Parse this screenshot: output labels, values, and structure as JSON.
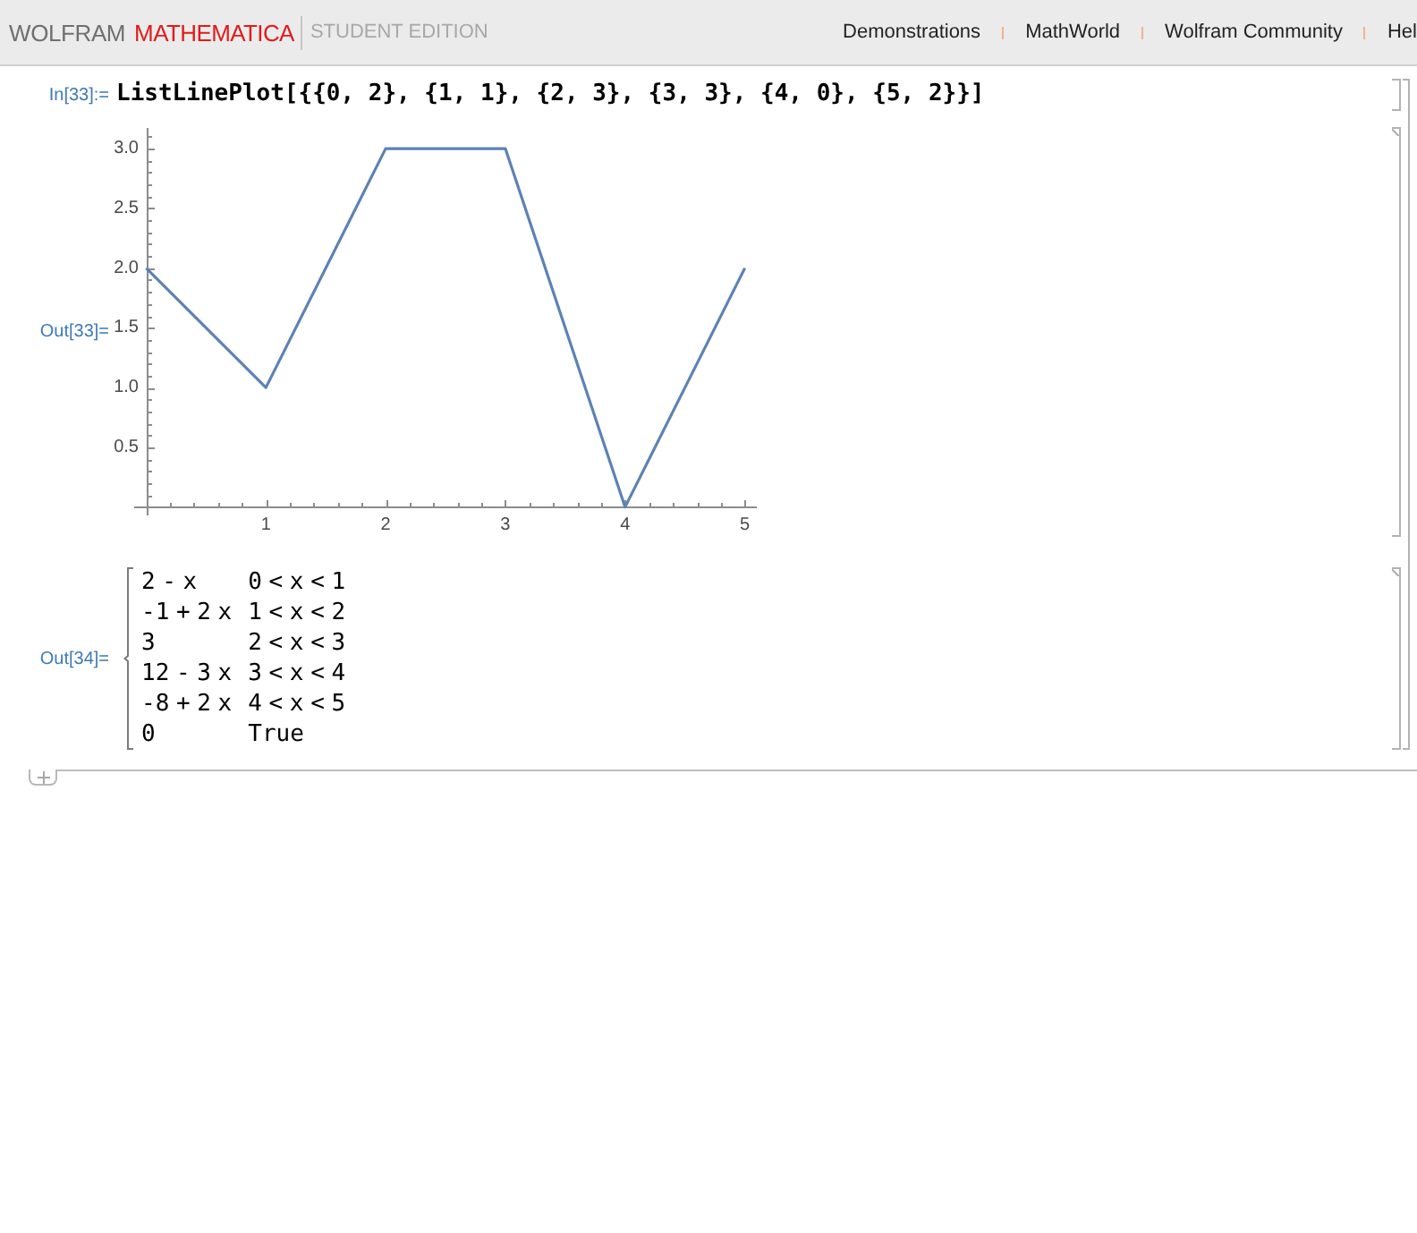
{
  "header": {
    "logo": {
      "brand": "WOLFRAM",
      "product": "MATHEMATICA",
      "edition": "STUDENT EDITION"
    },
    "links": [
      "Demonstrations",
      "MathWorld",
      "Wolfram Community",
      "Hel"
    ]
  },
  "notebook": {
    "cells": [
      {
        "kind": "input",
        "label": "In[33]:=",
        "code": "ListLinePlot[{{0, 2}, {1, 1}, {2, 3}, {3, 3}, {4, 0}, {5, 2}}]"
      },
      {
        "kind": "plot",
        "label": "Out[33]=",
        "chart_data": {
          "type": "line",
          "x": [
            0,
            1,
            2,
            3,
            4,
            5
          ],
          "series": [
            {
              "color": "#5e81b5",
              "values": [
                2,
                1,
                3,
                3,
                0,
                2
              ]
            }
          ],
          "xlim": [
            -0.1,
            5.1
          ],
          "ylim": [
            -0.07,
            3.17
          ],
          "xticks": [
            1,
            2,
            3,
            4,
            5
          ],
          "yticks": [
            0.5,
            {
              "value": 1,
              "label": "1.0"
            },
            1.5,
            {
              "value": 2,
              "label": "2.0"
            },
            2.5,
            {
              "value": 3,
              "label": "3.0"
            }
          ]
        }
      },
      {
        "kind": "piecewise",
        "label": "Out[34]=",
        "rows": [
          {
            "expression": "2 - x",
            "condition": "0 < x < 1"
          },
          {
            "expression": "-1 + 2 x",
            "condition": "1 < x < 2"
          },
          {
            "expression": "3",
            "condition": "2 < x < 3"
          },
          {
            "expression": "12 - 3 x",
            "condition": "3 < x < 4"
          },
          {
            "expression": "-8 + 2 x",
            "condition": "4 < x < 5"
          },
          {
            "expression": "0",
            "condition": "True"
          }
        ]
      }
    ]
  }
}
